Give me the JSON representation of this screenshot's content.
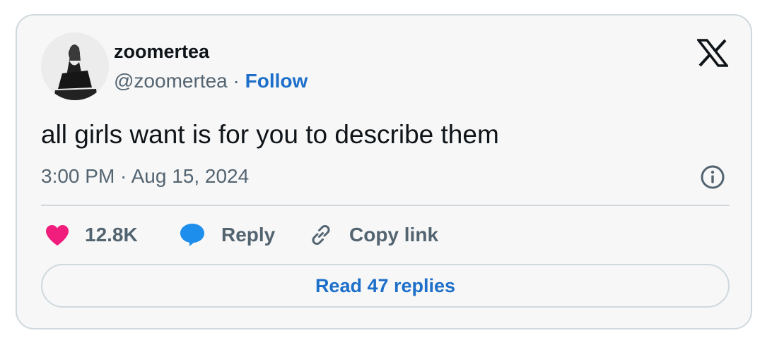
{
  "tweet": {
    "author_name": "zoomertea",
    "handle": "@zoomertea",
    "separator": "·",
    "follow_label": "Follow",
    "text": "all girls want is for you to describe them",
    "timestamp": "3:00 PM · Aug 15, 2024"
  },
  "actions": {
    "like_count": "12.8K",
    "reply_label": "Reply",
    "copy_link_label": "Copy link"
  },
  "read_replies_label": "Read 47 replies",
  "icons": {
    "brand": "x-logo-icon",
    "info": "info-icon",
    "like": "heart-icon",
    "reply": "speech-bubble-icon",
    "copy": "link-icon"
  },
  "colors": {
    "accent": "#1d6fc9",
    "like": "#f01d7d",
    "reply": "#1d8eeb",
    "muted_text": "#536471",
    "border": "#cfd9de"
  }
}
